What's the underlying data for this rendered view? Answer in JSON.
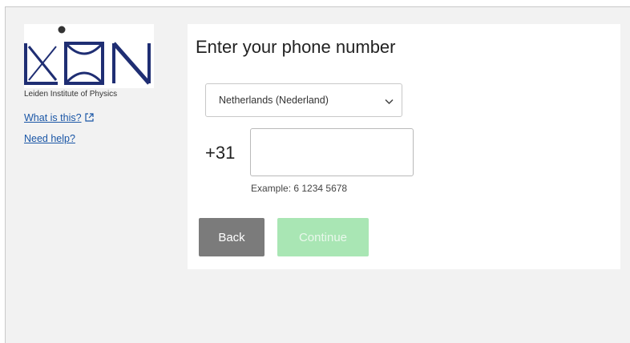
{
  "sidebar": {
    "logo_text": "LION",
    "logo_caption": "Leiden Institute of Physics",
    "links": [
      {
        "label": "What is this?",
        "icon": "external-link-icon"
      },
      {
        "label": "Need help?"
      }
    ]
  },
  "main": {
    "title": "Enter your phone number",
    "country_select": {
      "value": "Netherlands (Nederland)",
      "icon": "chevron-down-icon"
    },
    "phone_prefix": "+31",
    "phone_input": {
      "value": "",
      "placeholder": ""
    },
    "example_hint": "Example: 6 1234 5678",
    "buttons": {
      "back": "Back",
      "continue": "Continue"
    }
  },
  "colors": {
    "page_background": "#f2f2f2",
    "panel_background": "#ffffff",
    "link": "#1a56a6",
    "back_button": "#7b7b7b",
    "continue_button_disabled": "#a9e6b4",
    "logo_navy": "#1f2e73"
  }
}
